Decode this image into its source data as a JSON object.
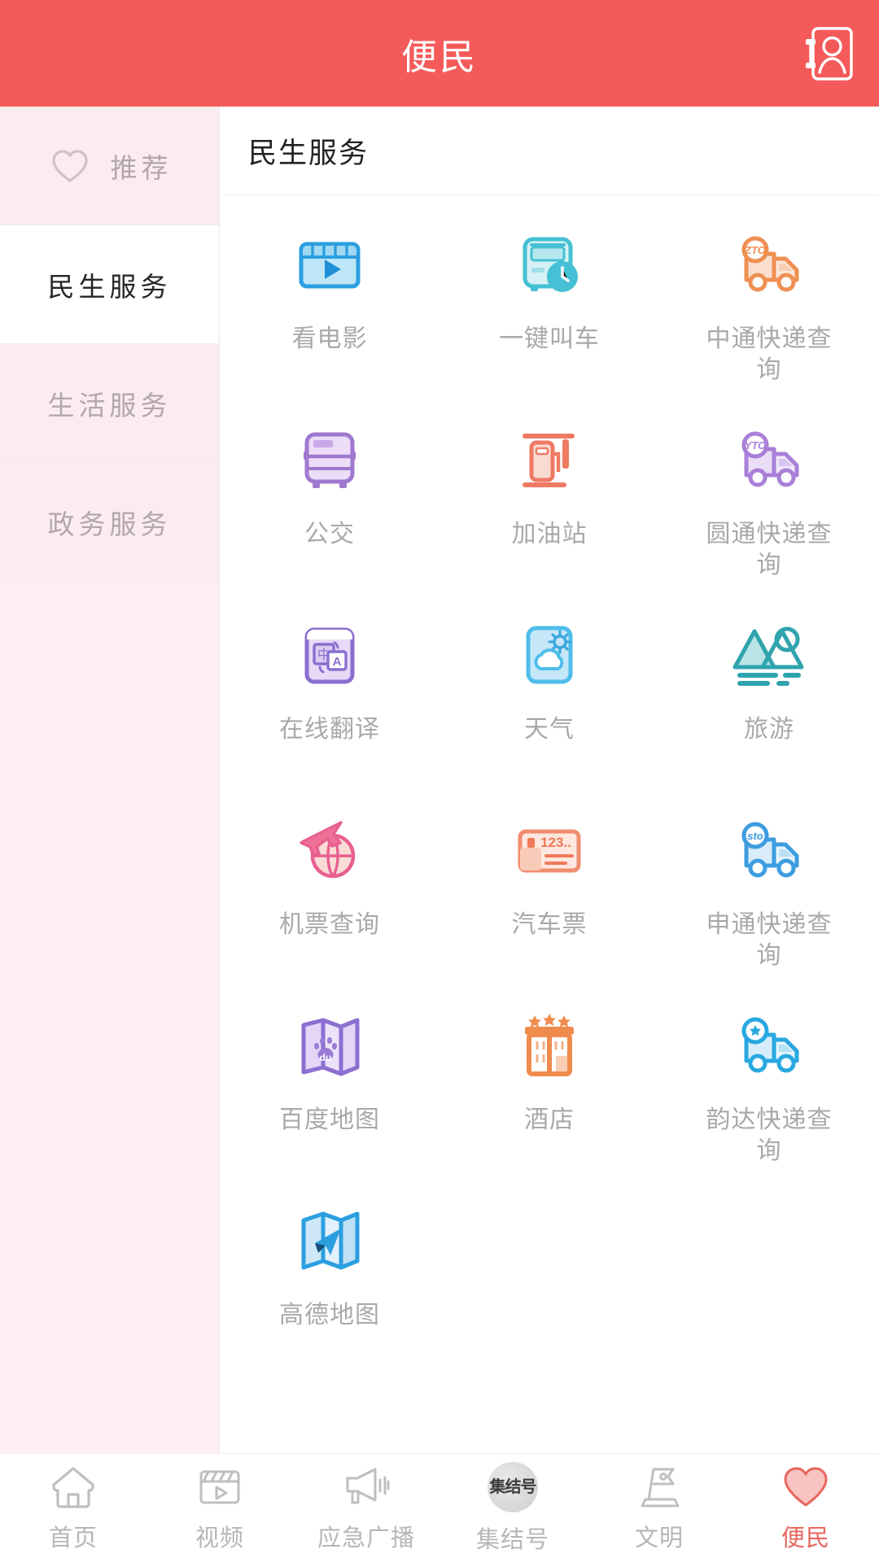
{
  "header": {
    "title": "便民",
    "action_icon": "contact-book-icon",
    "bg_color": "#f55a5a"
  },
  "sidebar": {
    "items": [
      {
        "label": "推荐",
        "icon": "heart-outline-icon",
        "active": false
      },
      {
        "label": "民生服务",
        "icon": "",
        "active": true
      },
      {
        "label": "生活服务",
        "icon": "",
        "active": false
      },
      {
        "label": "政务服务",
        "icon": "",
        "active": false
      }
    ]
  },
  "section": {
    "title": "民生服务"
  },
  "services": [
    {
      "label": "看电影",
      "icon": "film-play-icon",
      "color": "#29a3e0"
    },
    {
      "label": "一键叫车",
      "icon": "taxi-clock-icon",
      "color": "#46c0d4"
    },
    {
      "label": "中通快递查询",
      "icon": "zto-truck-icon",
      "color": "#ef8f52"
    },
    {
      "label": "公交",
      "icon": "bus-icon",
      "color": "#9f79d0"
    },
    {
      "label": "加油站",
      "icon": "gas-station-icon",
      "color": "#ef7a63"
    },
    {
      "label": "圆通快递查询",
      "icon": "yto-truck-icon",
      "color": "#a97fd8"
    },
    {
      "label": "在线翻译",
      "icon": "translate-icon",
      "color": "#8a6fd0"
    },
    {
      "label": "天气",
      "icon": "weather-icon",
      "color": "#4fbdea"
    },
    {
      "label": "旅游",
      "icon": "travel-mountain-icon",
      "color": "#2fa3ae"
    },
    {
      "label": "机票查询",
      "icon": "flight-globe-icon",
      "color": "#e8608f"
    },
    {
      "label": "汽车票",
      "icon": "bus-ticket-icon",
      "color": "#f08d6f"
    },
    {
      "label": "申通快递查询",
      "icon": "sto-truck-icon",
      "color": "#3d9de0"
    },
    {
      "label": "百度地图",
      "icon": "baidu-map-icon",
      "color": "#8c6fd1"
    },
    {
      "label": "酒店",
      "icon": "hotel-icon",
      "color": "#f08b4e"
    },
    {
      "label": "韵达快递查询",
      "icon": "yunda-truck-icon",
      "color": "#28a8e0"
    },
    {
      "label": "高德地图",
      "icon": "amap-icon",
      "color": "#2b9fe0"
    }
  ],
  "tabbar": {
    "items": [
      {
        "label": "首页",
        "icon": "home-icon",
        "active": false
      },
      {
        "label": "视频",
        "icon": "video-icon",
        "active": false
      },
      {
        "label": "应急广播",
        "icon": "megaphone-icon",
        "active": false
      },
      {
        "label": "集结号",
        "icon": "jijiehao-seal-icon",
        "active": false,
        "seal_text": "集结号"
      },
      {
        "label": "文明",
        "icon": "flag-icon",
        "active": false
      },
      {
        "label": "便民",
        "icon": "heart-filled-icon",
        "active": true
      }
    ],
    "active_color": "#e8675f",
    "inactive_color": "#b6b6b6"
  }
}
